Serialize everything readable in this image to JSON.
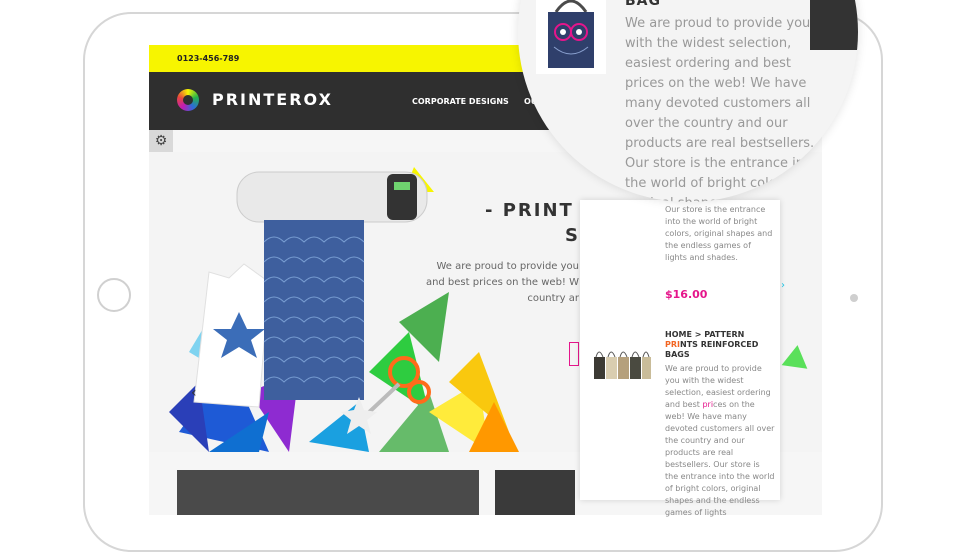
{
  "topbar": {
    "phone": "0123-456-789"
  },
  "header": {
    "logo": "PRINTEROX",
    "nav": [
      "CORPORATE DESIGNS",
      "OUT"
    ]
  },
  "settings_icon": "gear-icon",
  "hero": {
    "headline_line1": "- PRINT I",
    "headline_line2": "S",
    "text_lines": [
      "We are proud to provide you",
      "and best prices on the web! W",
      "country ar"
    ],
    "prev_arrow": "‹"
  },
  "panel": {
    "text_top": "Our store is the entrance into the world of bright colors, original shapes and the endless games of lights and shades.",
    "price": "$16.00",
    "next_arrow": "›",
    "product_title_1": "HOME > PATTERN ",
    "product_title_hl": "PRI",
    "product_title_2": "NTS REINFORCED BAGS",
    "desc_1": "We are proud to provide you with the widest selection, easiest ordering and best ",
    "desc_hl": "pri",
    "desc_2": "ces on the web! We have many devoted customers all over the country and our products are real bestsellers. Our store is the entrance into the world of bright colors, original shapes and the endless games of lights"
  },
  "magnifier": {
    "title": "BAG",
    "text": "We are proud to provide you with the widest selection, easiest ordering and best prices on the web! We have many devoted customers all over the country and our products are real bestsellers. Our store is the entrance into the world of bright colors, original shapes and"
  },
  "colors": {
    "yellow": "#f7f500",
    "dark": "#2f2f2f",
    "pink": "#e5158b",
    "cyan": "#1fc3e3"
  }
}
